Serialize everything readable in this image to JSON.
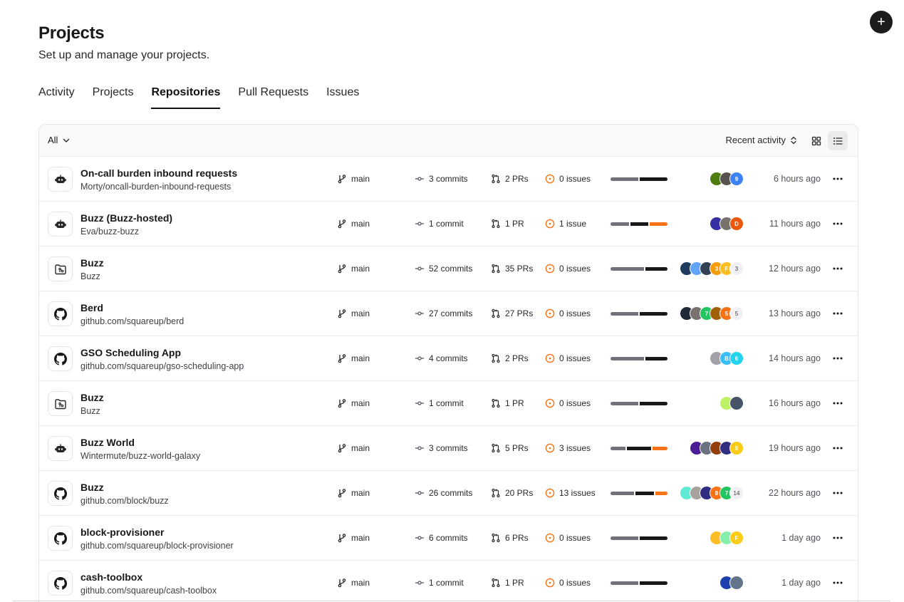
{
  "header": {
    "title": "Projects",
    "subtitle": "Set up and manage your projects.",
    "add_button_label": "+"
  },
  "tabs": [
    {
      "label": "Activity",
      "active": false
    },
    {
      "label": "Projects",
      "active": false
    },
    {
      "label": "Repositories",
      "active": true
    },
    {
      "label": "Pull Requests",
      "active": false
    },
    {
      "label": "Issues",
      "active": false
    }
  ],
  "toolbar": {
    "filter_label": "All",
    "sort_label": "Recent activity",
    "view_modes": [
      "grid-view-icon",
      "list-view-icon"
    ],
    "active_view": "list"
  },
  "colors": {
    "bar_grey": "#71717a",
    "bar_dark": "#18181b",
    "bar_orange": "#f97316",
    "issue_icon": "#f97316"
  },
  "repos": [
    {
      "name": "On-call burden inbound requests",
      "path": "Morty/oncall-burden-inbound-requests",
      "icon": "bot-icon",
      "branch": "main",
      "commits": "3 commits",
      "prs": "2 PRs",
      "issues": "0 issues",
      "activity": [
        50,
        50,
        0
      ],
      "avatars": [
        {
          "bg": "#4d7c0f",
          "text": ""
        },
        {
          "bg": "#57534e",
          "text": ""
        },
        {
          "bg": "#3b82f6",
          "text": "9"
        }
      ],
      "more": "",
      "time": "6 hours ago"
    },
    {
      "name": "Buzz (Buzz-hosted)",
      "path": "Eva/buzz-buzz",
      "icon": "bot-icon",
      "branch": "main",
      "commits": "1 commit",
      "prs": "1 PR",
      "issues": "1 issue",
      "activity": [
        34,
        33,
        33
      ],
      "avatars": [
        {
          "bg": "#3730a3",
          "text": ""
        },
        {
          "bg": "#78716c",
          "text": ""
        },
        {
          "bg": "#ea580c",
          "text": "D"
        }
      ],
      "more": "",
      "time": "11 hours ago"
    },
    {
      "name": "Buzz",
      "path": "Buzz",
      "icon": "folder-git-icon",
      "branch": "main",
      "commits": "52 commits",
      "prs": "35 PRs",
      "issues": "0 issues",
      "activity": [
        60,
        40,
        0
      ],
      "avatars": [
        {
          "bg": "#1e3a5f",
          "text": ""
        },
        {
          "bg": "#60a5fa",
          "text": ""
        },
        {
          "bg": "#334155",
          "text": ""
        },
        {
          "bg": "#f59e0b",
          "text": "3"
        },
        {
          "bg": "#fbbf24",
          "text": "F"
        }
      ],
      "more": "3",
      "time": "12 hours ago"
    },
    {
      "name": "Berd",
      "path": "github.com/squareup/berd",
      "icon": "github-icon",
      "branch": "main",
      "commits": "27 commits",
      "prs": "27 PRs",
      "issues": "0 issues",
      "activity": [
        50,
        50,
        0
      ],
      "avatars": [
        {
          "bg": "#1f2937",
          "text": ""
        },
        {
          "bg": "#78716c",
          "text": ""
        },
        {
          "bg": "#22c55e",
          "text": "7"
        },
        {
          "bg": "#a16207",
          "text": ""
        },
        {
          "bg": "#f97316",
          "text": "5"
        }
      ],
      "more": "5",
      "time": "13 hours ago"
    },
    {
      "name": "GSO Scheduling App",
      "path": "github.com/squareup/gso-scheduling-app",
      "icon": "github-icon",
      "branch": "main",
      "commits": "4 commits",
      "prs": "2 PRs",
      "issues": "0 issues",
      "activity": [
        60,
        40,
        0
      ],
      "avatars": [
        {
          "bg": "#a1a1aa",
          "text": ""
        },
        {
          "bg": "#38bdf8",
          "text": "B"
        },
        {
          "bg": "#22d3ee",
          "text": "6"
        }
      ],
      "more": "",
      "time": "14 hours ago"
    },
    {
      "name": "Buzz",
      "path": "Buzz",
      "icon": "folder-git-icon",
      "branch": "main",
      "commits": "1 commit",
      "prs": "1 PR",
      "issues": "0 issues",
      "activity": [
        50,
        50,
        0
      ],
      "avatars": [
        {
          "bg": "#bef264",
          "text": ""
        },
        {
          "bg": "#475569",
          "text": ""
        }
      ],
      "more": "",
      "time": "16 hours ago"
    },
    {
      "name": "Buzz World",
      "path": "Wintermute/buzz-world-galaxy",
      "icon": "bot-icon",
      "branch": "main",
      "commits": "3 commits",
      "prs": "5 PRs",
      "issues": "3 issues",
      "activity": [
        28,
        44,
        28
      ],
      "avatars": [
        {
          "bg": "#4c1d95",
          "text": ""
        },
        {
          "bg": "#6b7280",
          "text": ""
        },
        {
          "bg": "#92400e",
          "text": ""
        },
        {
          "bg": "#312e81",
          "text": ""
        },
        {
          "bg": "#facc15",
          "text": "9"
        }
      ],
      "more": "",
      "time": "19 hours ago"
    },
    {
      "name": "Buzz",
      "path": "github.com/block/buzz",
      "icon": "github-icon",
      "branch": "main",
      "commits": "26 commits",
      "prs": "20 PRs",
      "issues": "13 issues",
      "activity": [
        44,
        33,
        23
      ],
      "avatars": [
        {
          "bg": "#5eead4",
          "text": ""
        },
        {
          "bg": "#a8a29e",
          "text": ""
        },
        {
          "bg": "#312e81",
          "text": ""
        },
        {
          "bg": "#f97316",
          "text": "8"
        },
        {
          "bg": "#22c55e",
          "text": "7"
        }
      ],
      "more": "14",
      "time": "22 hours ago"
    },
    {
      "name": "block-provisioner",
      "path": "github.com/squareup/block-provisioner",
      "icon": "github-icon",
      "branch": "main",
      "commits": "6 commits",
      "prs": "6 PRs",
      "issues": "0 issues",
      "activity": [
        50,
        50,
        0
      ],
      "avatars": [
        {
          "bg": "#fbbf24",
          "text": ""
        },
        {
          "bg": "#86efac",
          "text": ""
        },
        {
          "bg": "#facc15",
          "text": "F"
        }
      ],
      "more": "",
      "time": "1 day ago"
    },
    {
      "name": "cash-toolbox",
      "path": "github.com/squareup/cash-toolbox",
      "icon": "github-icon",
      "branch": "main",
      "commits": "1 commit",
      "prs": "1 PR",
      "issues": "0 issues",
      "activity": [
        50,
        50,
        0
      ],
      "avatars": [
        {
          "bg": "#1e40af",
          "text": ""
        },
        {
          "bg": "#64748b",
          "text": ""
        }
      ],
      "more": "",
      "time": "1 day ago"
    }
  ]
}
